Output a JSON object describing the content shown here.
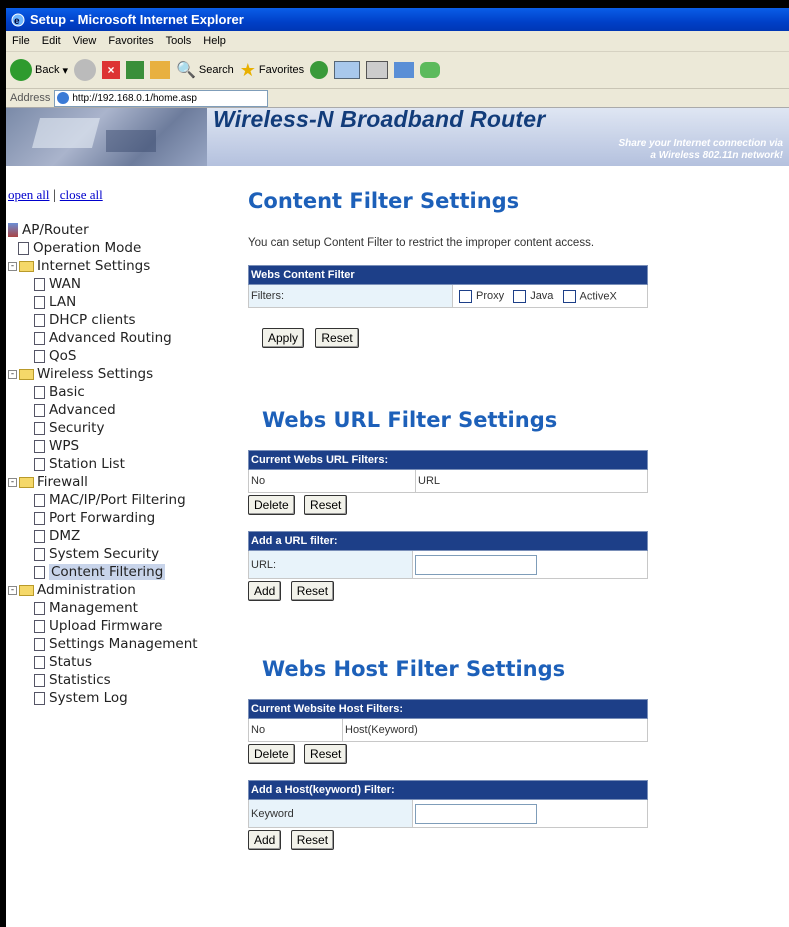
{
  "window": {
    "title": "Setup - Microsoft Internet Explorer"
  },
  "menu": [
    "File",
    "Edit",
    "View",
    "Favorites",
    "Tools",
    "Help"
  ],
  "toolbar": {
    "back": "Back",
    "search": "Search",
    "favorites": "Favorites"
  },
  "address": {
    "label": "Address",
    "url": "http://192.168.0.1/home.asp"
  },
  "banner": {
    "title": "Wireless-N Broadband Router",
    "tagline1": "Share your Internet connection via",
    "tagline2": "a Wireless 802.11n network!"
  },
  "sidebar": {
    "open_all": "open all",
    "separator": "|",
    "close_all": "close all",
    "root": "AP/Router",
    "operation_mode": "Operation Mode",
    "internet": {
      "label": "Internet Settings",
      "items": [
        "WAN",
        "LAN",
        "DHCP clients",
        "Advanced Routing",
        "QoS"
      ]
    },
    "wireless": {
      "label": "Wireless Settings",
      "items": [
        "Basic",
        "Advanced",
        "Security",
        "WPS",
        "Station List"
      ]
    },
    "firewall": {
      "label": "Firewall",
      "items": [
        "MAC/IP/Port Filtering",
        "Port Forwarding",
        "DMZ",
        "System Security",
        "Content Filtering"
      ]
    },
    "admin": {
      "label": "Administration",
      "items": [
        "Management",
        "Upload Firmware",
        "Settings Management",
        "Status",
        "Statistics",
        "System Log"
      ]
    }
  },
  "content_filter": {
    "title": "Content Filter Settings",
    "description": "You can setup Content Filter to restrict the improper content access.",
    "table_header": "Webs Content Filter",
    "filters_label": "Filters:",
    "options": [
      "Proxy",
      "Java",
      "ActiveX"
    ],
    "apply": "Apply",
    "reset": "Reset"
  },
  "url_filter": {
    "title": "Webs URL Filter Settings",
    "current_header": "Current Webs URL Filters:",
    "col_no": "No",
    "col_url": "URL",
    "delete": "Delete",
    "reset": "Reset",
    "add_header": "Add a URL filter:",
    "url_label": "URL:",
    "add": "Add",
    "reset2": "Reset"
  },
  "host_filter": {
    "title": "Webs Host Filter Settings",
    "current_header": "Current Website Host Filters:",
    "col_no": "No",
    "col_host": "Host(Keyword)",
    "delete": "Delete",
    "reset": "Reset",
    "add_header": "Add a Host(keyword) Filter:",
    "keyword_label": "Keyword",
    "add": "Add",
    "reset2": "Reset"
  }
}
